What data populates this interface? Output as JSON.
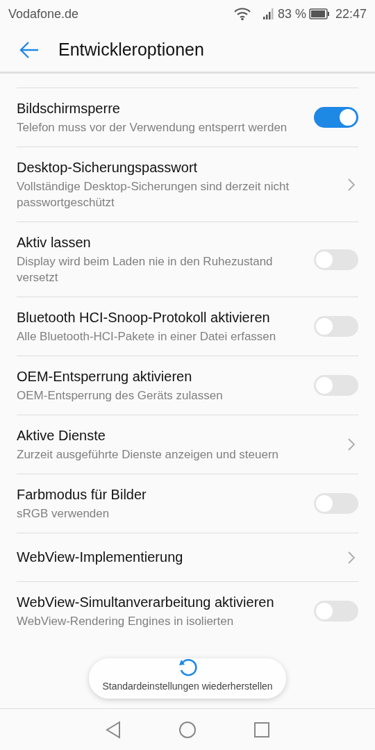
{
  "status_bar": {
    "carrier": "Vodafone.de",
    "battery": "83 %",
    "time": "22:47"
  },
  "header": {
    "title": "Entwickleroptionen"
  },
  "settings": [
    {
      "kind": "toggle",
      "title": "Bildschirmsperre",
      "subtitle": "Telefon muss vor der Verwendung entsperrt werden",
      "on": true
    },
    {
      "kind": "link",
      "title": "Desktop-Sicherungspasswort",
      "subtitle": "Vollständige Desktop-Sicherungen sind derzeit nicht passwortgeschützt"
    },
    {
      "kind": "toggle",
      "title": "Aktiv lassen",
      "subtitle": "Display wird beim Laden nie in den Ruhezustand versetzt",
      "on": false
    },
    {
      "kind": "toggle",
      "title": "Bluetooth HCI-Snoop-Protokoll aktivieren",
      "subtitle": "Alle Bluetooth-HCI-Pakete in einer Datei erfassen",
      "on": false
    },
    {
      "kind": "toggle",
      "title": "OEM-Entsperrung aktivieren",
      "subtitle": "OEM-Entsperrung des Geräts zulassen",
      "on": false
    },
    {
      "kind": "link",
      "title": "Aktive Dienste",
      "subtitle": "Zurzeit ausgeführte Dienste anzeigen und steuern"
    },
    {
      "kind": "toggle",
      "title": "Farbmodus für Bilder",
      "subtitle": "sRGB verwenden",
      "on": false
    },
    {
      "kind": "link",
      "title": "WebView-Implementierung"
    },
    {
      "kind": "toggle",
      "title": "WebView-Simultanverarbeitung aktivieren",
      "subtitle": "WebView-Rendering Engines in isolierten",
      "on": false
    }
  ],
  "toast": {
    "text": "Standardeinstellungen wiederherstellen"
  }
}
